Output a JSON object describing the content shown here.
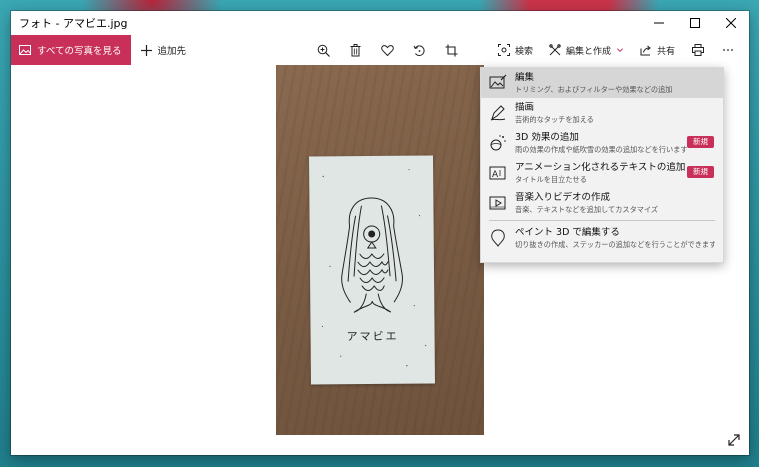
{
  "window": {
    "title": "フォト - アマビエ.jpg"
  },
  "toolbar": {
    "all_photos_label": "すべての写真を見る",
    "add_label": "追加先",
    "search_label": "検索",
    "edit_create_label": "編集と作成",
    "share_label": "共有"
  },
  "colors": {
    "accent": "#c8305a",
    "menu_bg": "#f2f2f2",
    "menu_active": "#d6d6d6"
  },
  "photo": {
    "card_caption": "アマビエ"
  },
  "menu": {
    "items": [
      {
        "label": "編集",
        "desc": "トリミング、およびフィルターや効果などの追加",
        "icon": "edit-photo-icon"
      },
      {
        "label": "描画",
        "desc": "芸術的なタッチを加える",
        "icon": "pen-draw-icon"
      },
      {
        "label": "3D 効果の追加",
        "desc": "雨の効果の作成や紙吹雪の効果の追加などを行います",
        "badge": "新規",
        "icon": "3d-effects-icon"
      },
      {
        "label": "アニメーション化されるテキストの追加",
        "desc": "タイトルを目立たせる",
        "badge": "新規",
        "icon": "animated-text-icon"
      },
      {
        "label": "音楽入りビデオの作成",
        "desc": "音楽、テキストなどを追加してカスタマイズ",
        "icon": "video-music-icon"
      },
      {
        "label": "ペイント 3D で編集する",
        "desc": "切り抜きの作成、ステッカーの追加などを行うことができます",
        "icon": "paint3d-icon"
      }
    ]
  }
}
